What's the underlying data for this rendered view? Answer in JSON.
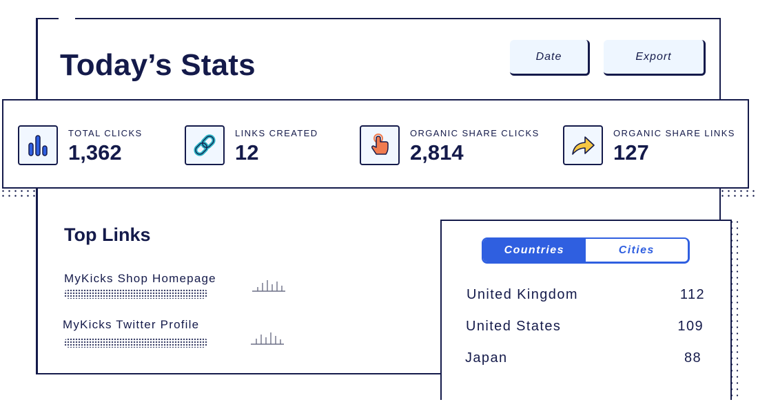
{
  "header": {
    "title": "Today’s Stats",
    "date_label": "Date",
    "export_label": "Export"
  },
  "stats": [
    {
      "label": "TOTAL CLICKS",
      "value": "1,362",
      "icon": "bar-chart-icon",
      "color": "#2f5fe0"
    },
    {
      "label": "LINKS CREATED",
      "value": "12",
      "icon": "link-icon",
      "color": "#2bb3c4"
    },
    {
      "label": "ORGANIC SHARE CLICKS",
      "value": "2,814",
      "icon": "tap-icon",
      "color": "#f07b4f"
    },
    {
      "label": "ORGANIC SHARE LINKS",
      "value": "127",
      "icon": "share-arrow-icon",
      "color": "#f6c743"
    }
  ],
  "top_links": {
    "title": "Top Links",
    "items": [
      {
        "name": "MyKicks Shop Homepage"
      },
      {
        "name": "MyKicks Twitter Profile"
      }
    ]
  },
  "locations": {
    "tabs": [
      "Countries",
      "Cities"
    ],
    "active_tab": "Countries",
    "rows": [
      {
        "name": "United Kingdom",
        "count": "112"
      },
      {
        "name": "United States",
        "count": "109"
      },
      {
        "name": "Japan",
        "count": "88"
      }
    ]
  },
  "colors": {
    "ink": "#141a4a",
    "accent": "#2f5fe0",
    "button_bg": "#eef6ff"
  }
}
